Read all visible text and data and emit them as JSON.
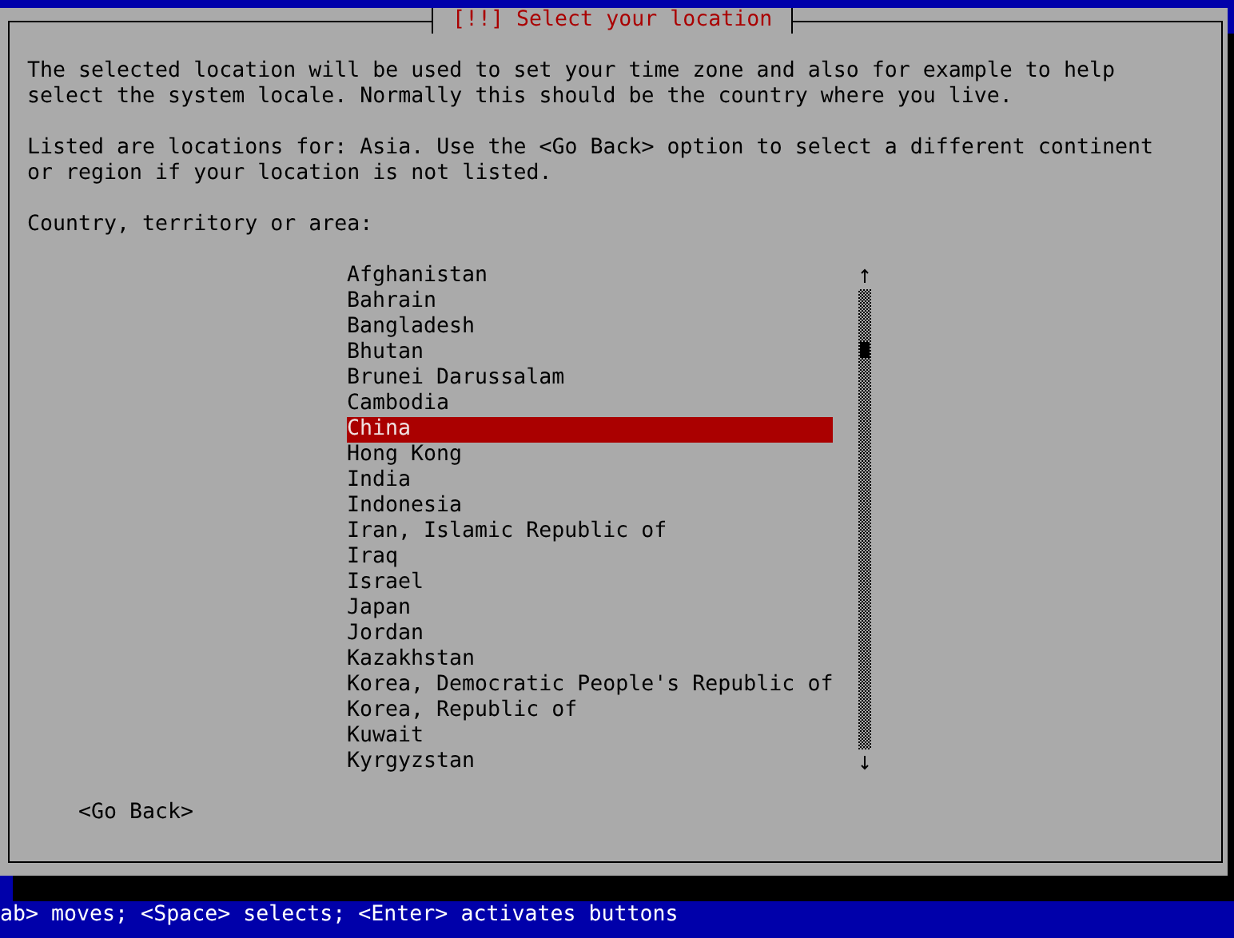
{
  "dialog": {
    "title": "[!!] Select your location",
    "paragraphs": [
      "The selected location will be used to set your time zone and also for example to help\nselect the system locale. Normally this should be the country where you live.",
      "Listed are locations for: Asia. Use the <Go Back> option to select a different continent\nor region if your location is not listed."
    ],
    "list_label": "Country, territory or area:",
    "countries": [
      {
        "label": "Afghanistan",
        "selected": false
      },
      {
        "label": "Bahrain",
        "selected": false
      },
      {
        "label": "Bangladesh",
        "selected": false
      },
      {
        "label": "Bhutan",
        "selected": false
      },
      {
        "label": "Brunei Darussalam",
        "selected": false
      },
      {
        "label": "Cambodia",
        "selected": false
      },
      {
        "label": "China",
        "selected": true
      },
      {
        "label": "Hong Kong",
        "selected": false
      },
      {
        "label": "India",
        "selected": false
      },
      {
        "label": "Indonesia",
        "selected": false
      },
      {
        "label": "Iran, Islamic Republic of",
        "selected": false
      },
      {
        "label": "Iraq",
        "selected": false
      },
      {
        "label": "Israel",
        "selected": false
      },
      {
        "label": "Japan",
        "selected": false
      },
      {
        "label": "Jordan",
        "selected": false
      },
      {
        "label": "Kazakhstan",
        "selected": false
      },
      {
        "label": "Korea, Democratic People's Republic of",
        "selected": false
      },
      {
        "label": "Korea, Republic of",
        "selected": false
      },
      {
        "label": "Kuwait",
        "selected": false
      },
      {
        "label": "Kyrgyzstan",
        "selected": false
      }
    ],
    "buttons": [
      "<Go Back>"
    ]
  },
  "status_bar": "ab> moves; <Space> selects; <Enter> activates buttons"
}
